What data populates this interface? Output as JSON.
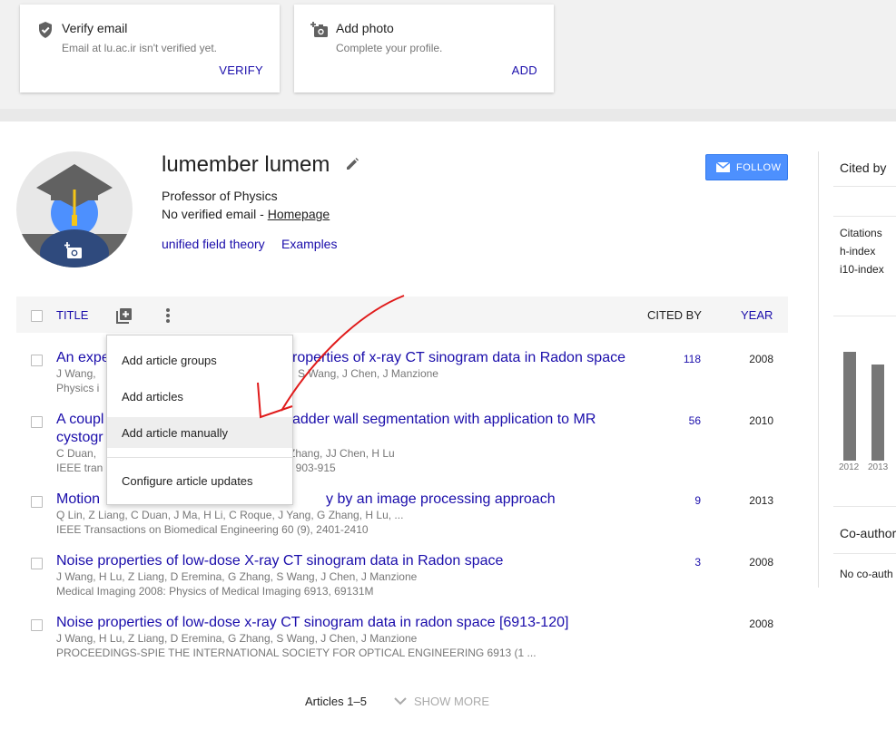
{
  "cards": [
    {
      "title": "Verify email",
      "subtitle": "Email at lu.ac.ir isn't verified yet.",
      "action": "VERIFY",
      "icon": "shield-check-icon"
    },
    {
      "title": "Add photo",
      "subtitle": "Complete your profile.",
      "action": "ADD",
      "icon": "add-photo-icon"
    }
  ],
  "profile": {
    "name": "lumember lumem",
    "affiliation": "Professor of Physics",
    "email_text": "No verified email - ",
    "homepage": "Homepage",
    "interests": [
      "unified field theory",
      "Examples"
    ],
    "follow": "FOLLOW"
  },
  "table": {
    "title_header": "TITLE",
    "cited_header": "CITED BY",
    "year_header": "YEAR",
    "rows": [
      {
        "title_left": "An expe",
        "title_right": "roperties of x-ray CT sinogram data in Radon space",
        "authors_left": "J Wang,",
        "authors_right": "S Wang, J Chen, J Manzione",
        "venue_left": "Physics i",
        "venue_right": "",
        "cited": "118",
        "year": "2008"
      },
      {
        "title_left": "A coupl",
        "title_left2": "cystogr",
        "title_right": "adder wall segmentation with application to MR",
        "authors_left": "C Duan,",
        "authors_right": "Zhang, JJ Chen, H Lu",
        "venue_left": "IEEE tran",
        "venue_right": ", 903-915",
        "cited": "56",
        "year": "2010"
      },
      {
        "title_left": "Motion",
        "title_right": "y by an image processing approach",
        "authors": "Q Lin, Z Liang, C Duan, J Ma, H Li, C Roque, J Yang, G Zhang, H Lu, ...",
        "venue": "IEEE Transactions on Biomedical Engineering 60 (9), 2401-2410",
        "cited": "9",
        "year": "2013"
      },
      {
        "title": "Noise properties of low-dose X-ray CT sinogram data in Radon space",
        "authors": "J Wang, H Lu, Z Liang, D Eremina, G Zhang, S Wang, J Chen, J Manzione",
        "venue": "Medical Imaging 2008: Physics of Medical Imaging 6913, 69131M",
        "cited": "3",
        "year": "2008"
      },
      {
        "title": "Noise properties of low-dose x-ray CT sinogram data in radon space [6913-120]",
        "authors": "J Wang, H Lu, Z Liang, D Eremina, G Zhang, S Wang, J Chen, J Manzione",
        "venue": "PROCEEDINGS-SPIE THE INTERNATIONAL SOCIETY FOR OPTICAL ENGINEERING 6913 (1 ...",
        "cited": "",
        "year": "2008"
      }
    ]
  },
  "menu": {
    "items": [
      "Add article groups",
      "Add articles",
      "Add article manually",
      "Configure article updates"
    ],
    "highlighted_index": 2
  },
  "footer": {
    "articles_label": "Articles 1–5",
    "show_more": "SHOW MORE"
  },
  "sidebar": {
    "cited_by": "Cited by",
    "metrics": [
      "Citations",
      "h-index",
      "i10-index"
    ],
    "chart_years": [
      "2012",
      "2013"
    ],
    "coauthors": "Co-author",
    "no_coauthors": "No co-auth"
  },
  "colors": {
    "link": "#1a0dab",
    "follow": "#4d90fe",
    "annotation_arrow": "#e01b1b"
  }
}
